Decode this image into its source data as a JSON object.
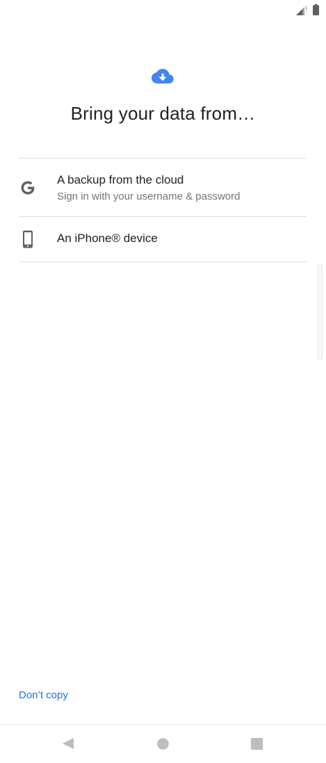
{
  "status_bar": {
    "icons": [
      "signal-icon",
      "battery-icon"
    ]
  },
  "header": {
    "icon": "cloud-download-icon",
    "title": "Bring your data from…"
  },
  "options": [
    {
      "icon": "google-g-icon",
      "title": "A backup from the cloud",
      "subtitle": "Sign in with your username & password"
    },
    {
      "icon": "phone-icon",
      "title": "An iPhone® device"
    }
  ],
  "footer": {
    "dont_copy_label": "Don’t copy"
  },
  "nav_bar": {
    "icons": [
      "back-icon",
      "home-icon",
      "recents-icon"
    ]
  },
  "colors": {
    "accent": "#1a73e8",
    "cloud_icon": "#4285f4",
    "text_primary": "#202124",
    "text_secondary": "#70757a",
    "divider": "#dadce0",
    "icon_gray": "#616161",
    "nav_gray": "#bdbdbd"
  }
}
